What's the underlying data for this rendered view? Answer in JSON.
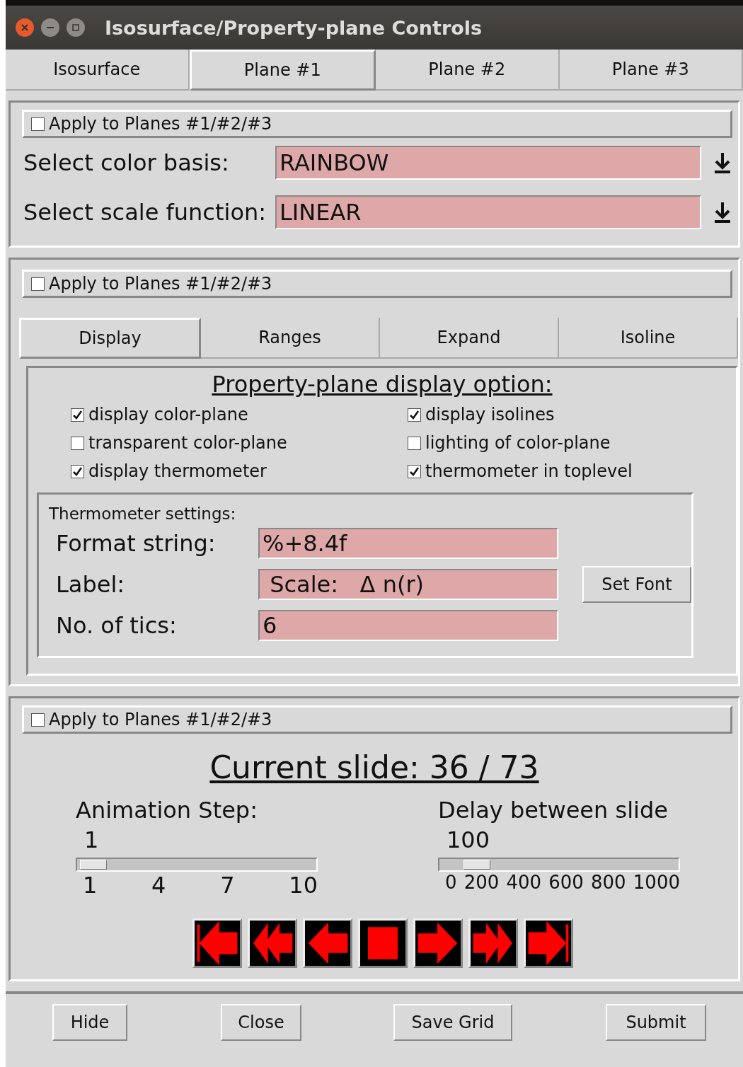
{
  "window": {
    "title": "Isosurface/Property-plane Controls"
  },
  "tabs": [
    {
      "label": "Isosurface",
      "selected": false
    },
    {
      "label": "Plane #1",
      "selected": true
    },
    {
      "label": "Plane #2",
      "selected": false
    },
    {
      "label": "Plane #3",
      "selected": false
    }
  ],
  "color_section": {
    "apply": {
      "label": "Apply to Planes #1/#2/#3",
      "checked": false
    },
    "fields": [
      {
        "label": "Select color basis:",
        "value": "RAINBOW"
      },
      {
        "label": "Select scale function:",
        "value": "LINEAR"
      }
    ]
  },
  "display_section": {
    "apply": {
      "label": "Apply to Planes #1/#2/#3",
      "checked": false
    },
    "tabs": [
      {
        "label": "Display",
        "selected": true
      },
      {
        "label": "Ranges",
        "selected": false
      },
      {
        "label": "Expand",
        "selected": false
      },
      {
        "label": "Isoline",
        "selected": false
      }
    ],
    "heading": "Property-plane display option:",
    "options": [
      {
        "label": "display color-plane",
        "checked": true
      },
      {
        "label": "display isolines",
        "checked": true
      },
      {
        "label": "transparent color-plane",
        "checked": false
      },
      {
        "label": "lighting of color-plane",
        "checked": false
      },
      {
        "label": "display thermometer",
        "checked": true
      },
      {
        "label": "thermometer in toplevel",
        "checked": true
      }
    ],
    "thermometer": {
      "title": "Thermometer settings:",
      "fields": [
        {
          "label": "Format string:",
          "value": "%+8.4f"
        },
        {
          "label": "Label:",
          "value": " Scale:   Δ n(r)"
        },
        {
          "label": "No. of tics:",
          "value": "6"
        }
      ],
      "button": "Set Font"
    }
  },
  "animation_section": {
    "apply": {
      "label": "Apply to Planes #1/#2/#3",
      "checked": false
    },
    "current_slide": "Current slide:  36 / 73",
    "sliders": [
      {
        "label": "Animation Step:",
        "value": "1",
        "level": 0,
        "ticks": [
          "1",
          "4",
          "7",
          "10"
        ]
      },
      {
        "label": "Delay between slide",
        "value": "100",
        "level": 0.1,
        "ticks": [
          "0",
          "200",
          "400",
          "600",
          "800",
          "1000"
        ]
      }
    ]
  },
  "buttons": [
    "Hide",
    "Close",
    "Save Grid",
    "Submit"
  ]
}
